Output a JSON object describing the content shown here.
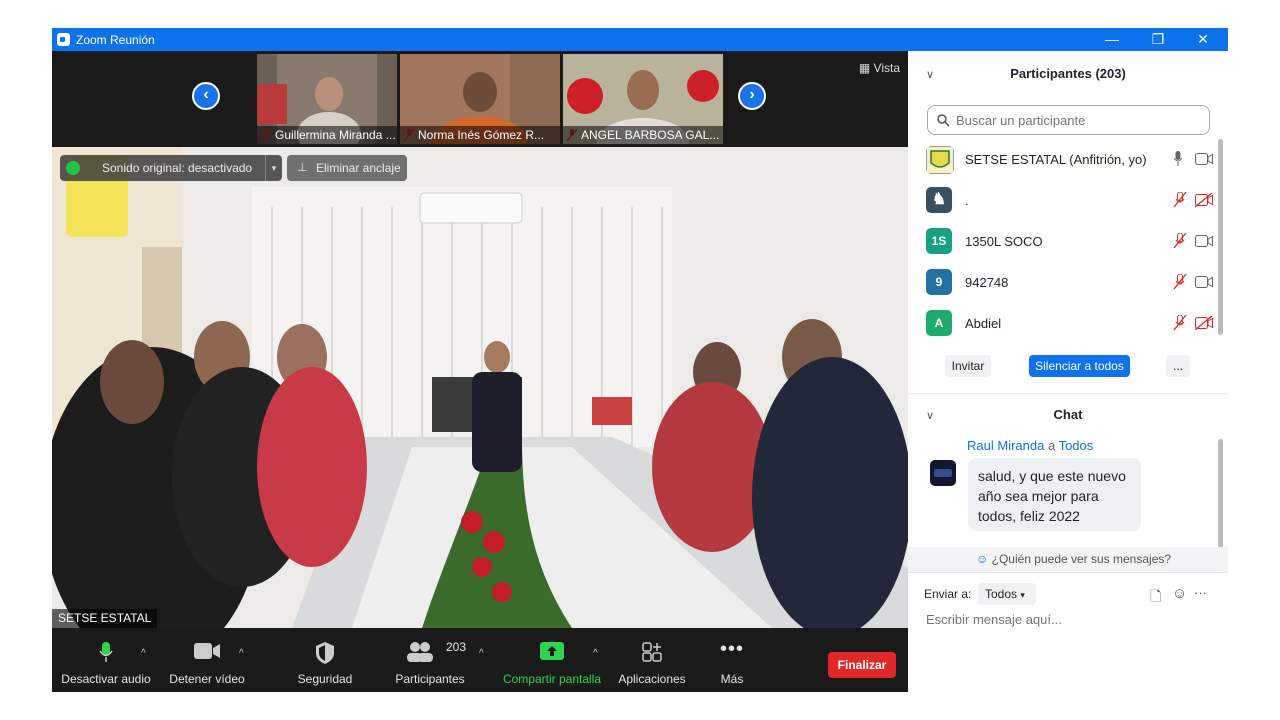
{
  "window": {
    "title": "Zoom Reunión",
    "minimize": "—",
    "restore": "❐",
    "close": "✕"
  },
  "strip": {
    "view_label": "Vista",
    "thumbnails": [
      {
        "name": "Guillermina Miranda ..."
      },
      {
        "name": "Norma Inés Gómez R..."
      },
      {
        "name": "ANGEL BARBOSA GAL..."
      }
    ]
  },
  "main_video": {
    "sound_button": "Sonido original: desactivado",
    "unpin_button": "Eliminar anclaje",
    "speaker_name": "SETSE ESTATAL"
  },
  "toolbar": {
    "mute": "Desactivar audio",
    "video": "Detener vídeo",
    "security": "Seguridad",
    "participants": "Participantes",
    "participants_count": "203",
    "share": "Compartir pantalla",
    "apps": "Aplicaciones",
    "more": "Más",
    "end": "Finalizar"
  },
  "participants": {
    "title": "Participantes (203)",
    "search_placeholder": "Buscar un participante",
    "list": [
      {
        "name": "SETSE ESTATAL (Anfitrión, yo)",
        "initials": "",
        "color": "#f6f2c6"
      },
      {
        "name": ".",
        "initials": "",
        "color": "#3a5060"
      },
      {
        "name": "1350L SOCO",
        "initials": "1S",
        "color": "#16a085"
      },
      {
        "name": "942748",
        "initials": "9",
        "color": "#2471a3"
      },
      {
        "name": "Abdiel",
        "initials": "A",
        "color": "#1eaa6a"
      }
    ],
    "invite": "Invitar",
    "mute_all": "Silenciar a todos",
    "more": "..."
  },
  "chat": {
    "title": "Chat",
    "sender": "Raul Miranda",
    "to_word": "a",
    "recipient": "Todos",
    "message": "salud, y que este nuevo año sea mejor para todos, feliz 2022",
    "who_can_see": "¿Quién puede ver sus mensajes?",
    "send_to_label": "Enviar a:",
    "send_to_value": "Todos",
    "input_placeholder": "Escribir mensaje aquí..."
  }
}
